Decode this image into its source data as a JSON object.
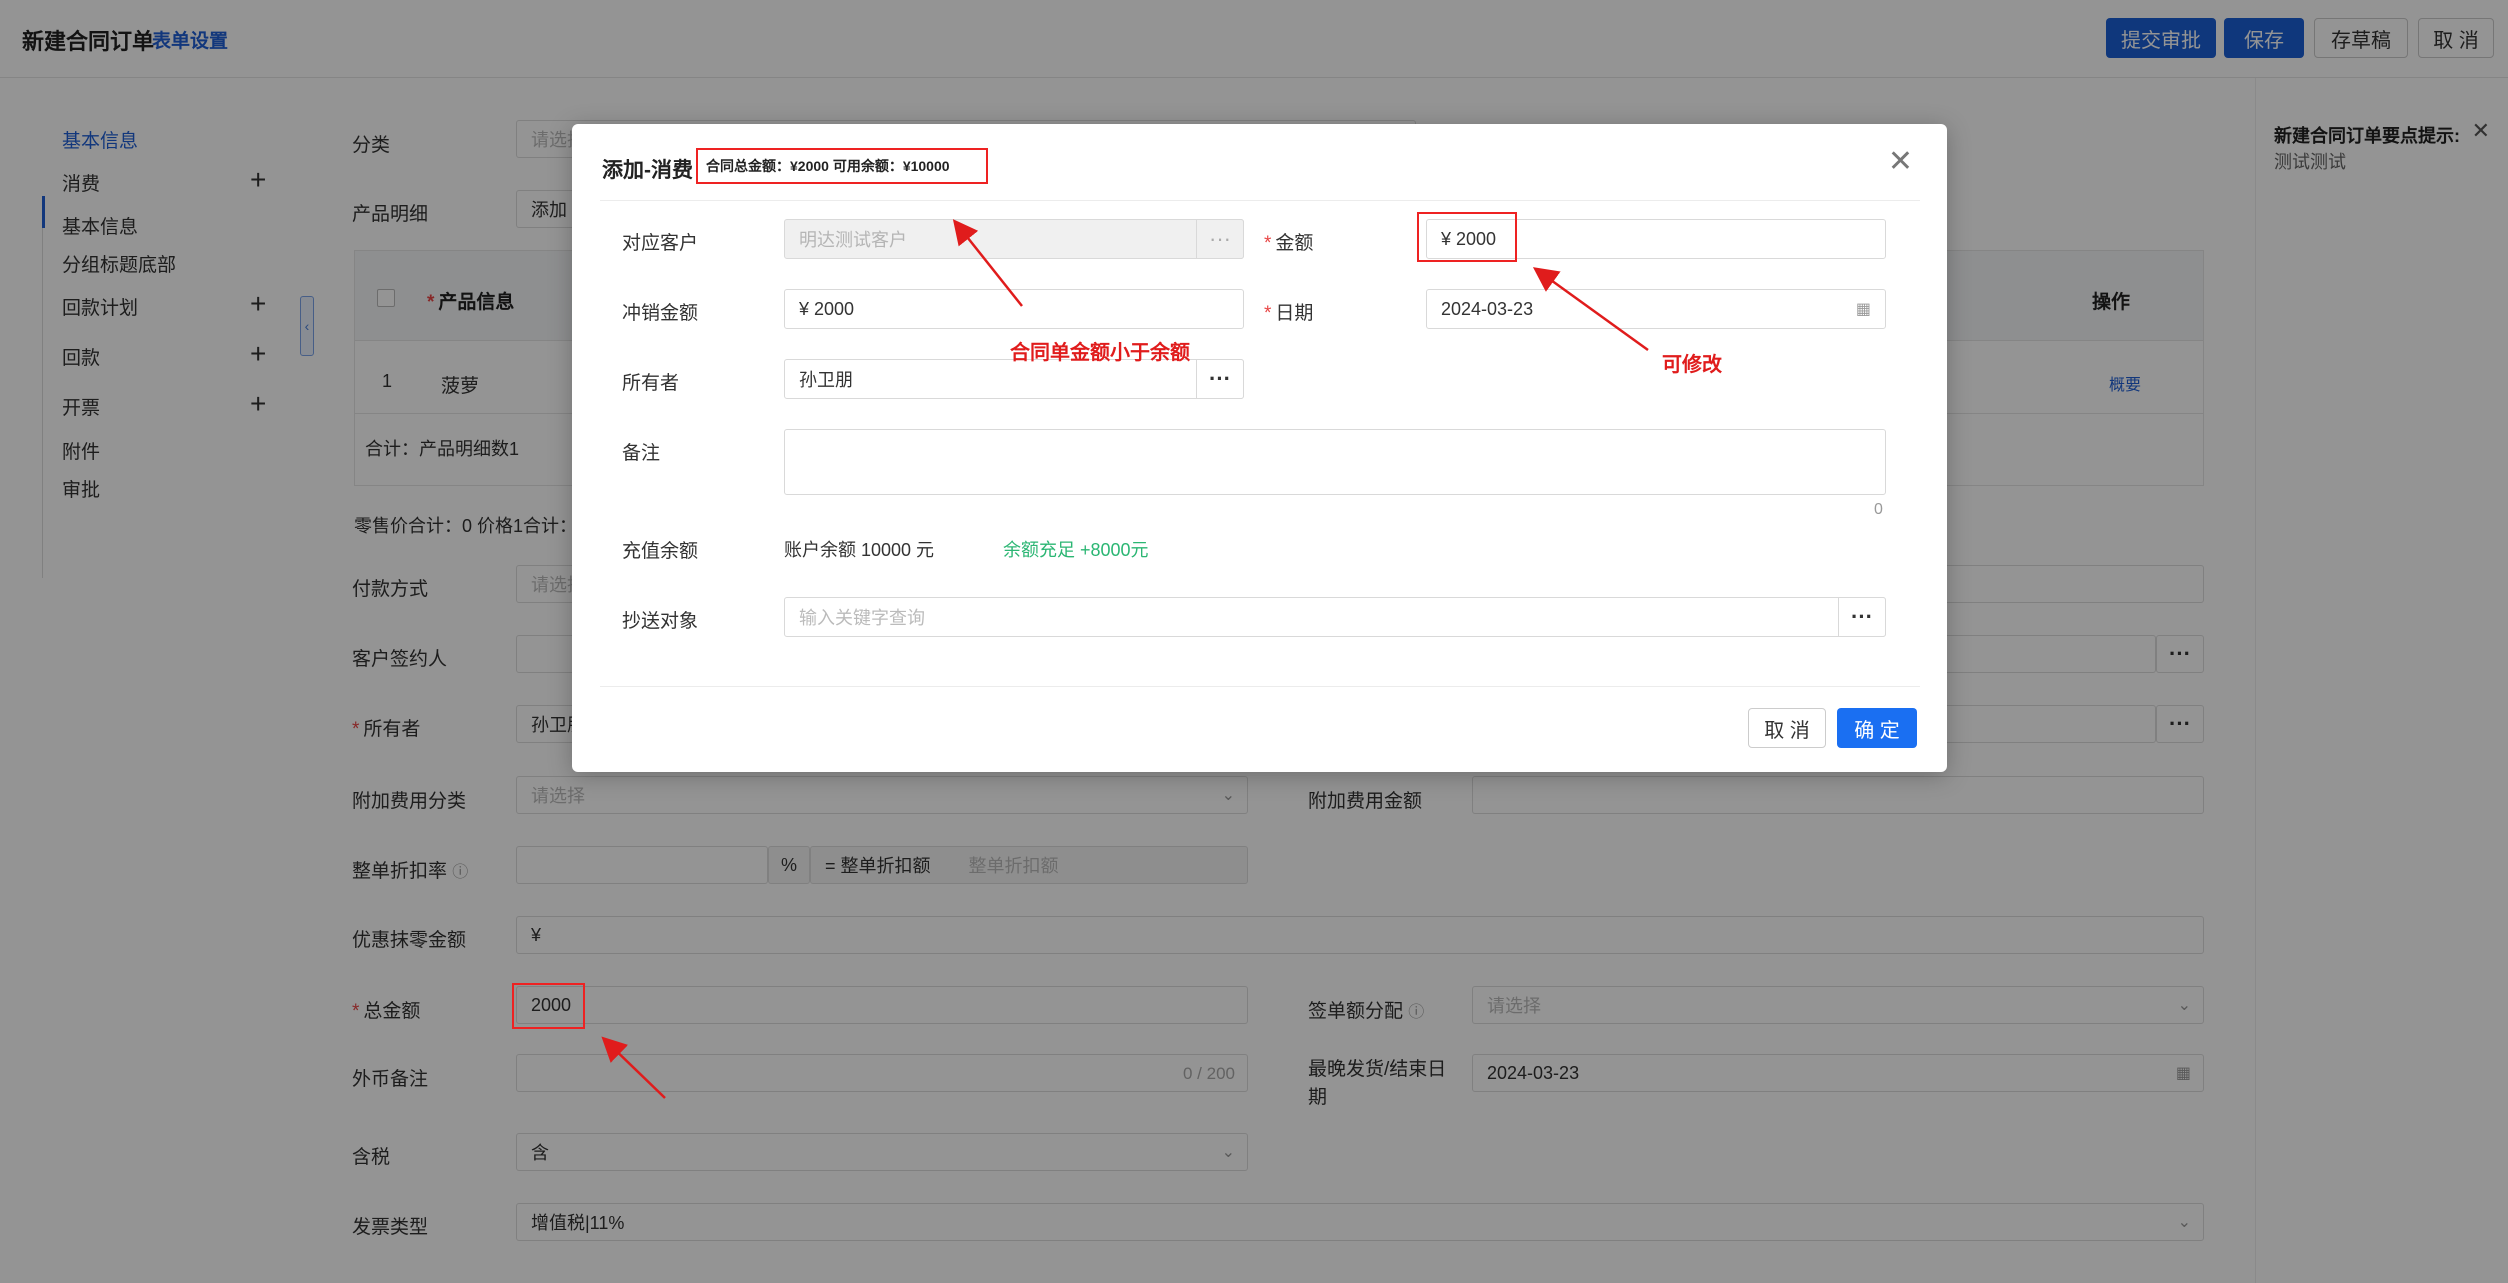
{
  "header": {
    "title": "新建合同订单",
    "settings_link": "表单设置",
    "buttons": {
      "submit": "提交审批",
      "save": "保存",
      "draft": "存草稿",
      "cancel": "取 消"
    }
  },
  "sidebar": {
    "items": [
      "基本信息",
      "消费",
      "基本信息",
      "分组标题底部",
      "回款计划",
      "回款",
      "开票",
      "附件",
      "审批"
    ],
    "plus": "+"
  },
  "form": {
    "category_label": "分类",
    "category_placeholder": "请选择",
    "product_detail_label": "产品明细",
    "add_label": "添加",
    "table": {
      "col_product": "产品信息",
      "col_action": "操作",
      "row_index": "1",
      "row_product": "菠萝",
      "row_action_link": "概要",
      "total_label": "合计：产品明细数1"
    },
    "summary_line": "零售价合计：0  价格1合计：",
    "payment_method_label": "付款方式",
    "payment_method_placeholder": "请选择",
    "customer_signer_label": "客户签约人",
    "owner_label": "所有者",
    "owner_value": "孙卫朋",
    "extra_fee_category_label": "附加费用分类",
    "extra_fee_category_placeholder": "请选择",
    "extra_fee_amount_label": "附加费用金额",
    "discount_rate_label": "整单折扣率",
    "percent": "%",
    "discount_amount_label": "= 整单折扣额",
    "discount_amount_placeholder": "整单折扣额",
    "rounding_label": "优惠抹零金额",
    "rounding_value": "¥",
    "total_amount_label": "总金额",
    "total_amount_value": "2000",
    "sign_allocation_label": "签单额分配",
    "sign_allocation_placeholder": "请选择",
    "fx_note_label": "外币备注",
    "fx_note_counter": "0 / 200",
    "latest_delivery_label": "最晚发货/结束日期",
    "latest_delivery_value": "2024-03-23",
    "tax_label": "含税",
    "tax_value": "含",
    "invoice_type_label": "发票类型",
    "invoice_type_value": "增值税|11%"
  },
  "right_panel": {
    "title": "新建合同订单要点提示:",
    "body": "测试测试"
  },
  "modal": {
    "title": "添加-消费",
    "summary": "合同总金额：¥2000  可用余额：¥10000",
    "customer_label": "对应客户",
    "customer_value": "明达测试客户",
    "amount_label": "金额",
    "amount_value": "¥  2000",
    "offset_label": "冲销金额",
    "offset_value": "¥  2000",
    "date_label": "日期",
    "date_value": "2024-03-23",
    "owner_label": "所有者",
    "owner_value": "孙卫朋",
    "remark_label": "备注",
    "remark_counter": "0",
    "recharge_label": "充值余额",
    "balance_text": "账户余额 10000 元",
    "balance_status": "余额充足 +8000元",
    "cc_label": "抄送对象",
    "cc_placeholder": "输入关键字查询",
    "cancel": "取 消",
    "ok": "确 定"
  },
  "annotations": {
    "note_contract_less": "合同单金额小于余额",
    "note_editable": "可修改"
  },
  "colors": {
    "primary": "#1a6ff2",
    "annotation": "#e01c1c",
    "success": "#2bb673"
  }
}
